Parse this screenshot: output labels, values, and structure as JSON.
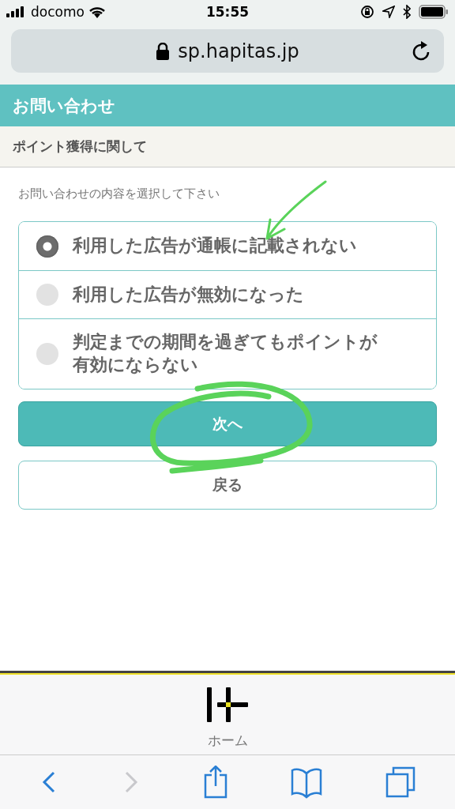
{
  "status_bar": {
    "carrier": "docomo",
    "time": "15:55"
  },
  "browser": {
    "url": "sp.hapitas.jp"
  },
  "page": {
    "title": "お問い合わせ",
    "section": "ポイント獲得に関して",
    "prompt": "お問い合わせの内容を選択して下さい",
    "options": [
      {
        "label": "利用した広告が通帳に記載されない",
        "selected": true
      },
      {
        "label": "利用した広告が無効になった",
        "selected": false
      },
      {
        "label": "判定までの期間を過ぎてもポイントが有効にならない",
        "selected": false
      }
    ],
    "next_button": "次へ",
    "back_button": "戻る"
  },
  "footer_tab": {
    "label": "ホーム"
  },
  "toolbar": [
    {
      "kind": "back",
      "disabled": false
    },
    {
      "kind": "forward",
      "disabled": true
    },
    {
      "kind": "share",
      "disabled": false
    },
    {
      "kind": "bookmarks",
      "disabled": false
    },
    {
      "kind": "tabs",
      "disabled": false
    }
  ]
}
